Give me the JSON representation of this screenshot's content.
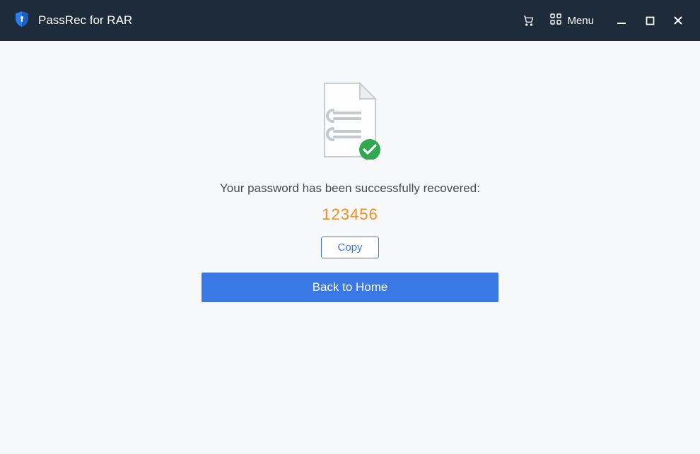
{
  "titlebar": {
    "app_title": "PassRec for RAR",
    "menu_label": "Menu"
  },
  "main": {
    "success_message": "Your password has been successfully recovered:",
    "recovered_password": "123456",
    "copy_label": "Copy",
    "home_label": "Back to Home"
  }
}
